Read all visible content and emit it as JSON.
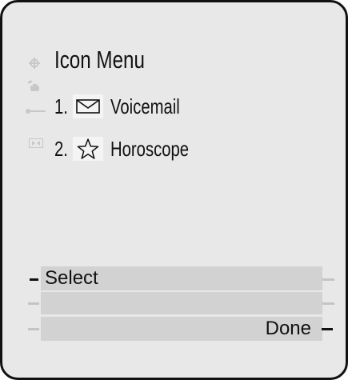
{
  "screen": {
    "title": "Icon Menu",
    "menu_items": [
      {
        "number": "1.",
        "icon": "envelope-icon",
        "label": "Voicemail"
      },
      {
        "number": "2.",
        "icon": "star-icon",
        "label": "Horoscope"
      }
    ],
    "side_icons": [
      "settings-gear-icon",
      "phone-handset-icon",
      "line-key-icon",
      "media-player-icon"
    ]
  },
  "softkeys": {
    "left_1": "Select",
    "left_2": "",
    "left_3": "",
    "right_1": "",
    "right_2": "",
    "right_3": "Done"
  },
  "colors": {
    "screen_bg": "#e8e8e8",
    "softkey_bar": "#d2d2d2",
    "text": "#111111",
    "faint_icon": "#c8c8c8"
  }
}
